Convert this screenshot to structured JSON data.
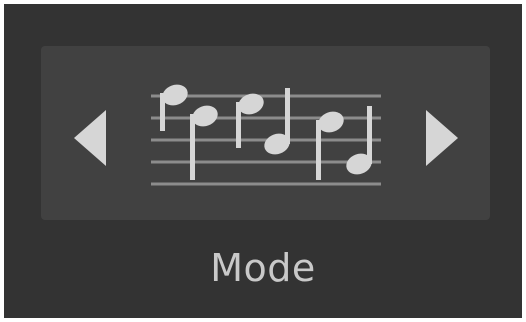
{
  "mode_selector": {
    "label": "Mode",
    "current_mode_icon": "music-notes-icon",
    "prev_icon": "triangle-left-icon",
    "next_icon": "triangle-right-icon"
  },
  "colors": {
    "frame_background": "#333333",
    "panel_background": "#414141",
    "glyph": "#d6d6d6",
    "label_text": "#c9c9c9"
  }
}
